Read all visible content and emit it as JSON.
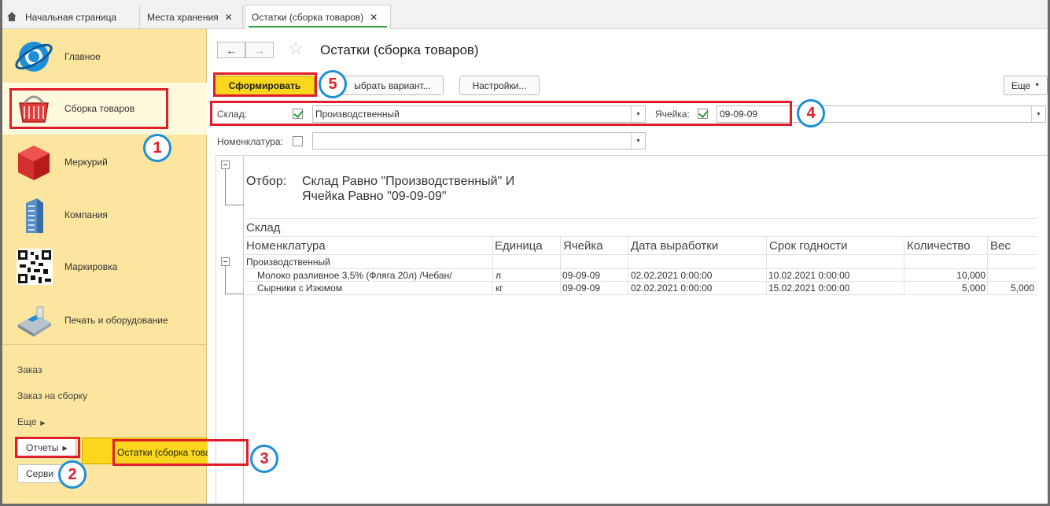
{
  "tabs": [
    {
      "label": "Начальная страница"
    },
    {
      "label": "Места хранения"
    },
    {
      "label": "Остатки (сборка товаров)"
    }
  ],
  "sidebar": {
    "sections": [
      {
        "label": "Главное",
        "icon": "globe-icon"
      },
      {
        "label": "Сборка товаров",
        "icon": "basket-icon"
      },
      {
        "label": "Меркурий",
        "icon": "cube-icon"
      },
      {
        "label": "Компания",
        "icon": "building-icon"
      },
      {
        "label": "Маркировка",
        "icon": "qr-code-icon"
      },
      {
        "label": "Печать и оборудование",
        "icon": "pos-terminal-icon"
      }
    ],
    "links": [
      {
        "label": "Заказ"
      },
      {
        "label": "Заказ на сборку"
      },
      {
        "label": "Еще"
      }
    ],
    "reports_button": "Отчеты",
    "service_button": "Серви"
  },
  "popup": {
    "item": "Остатки (сборка товаров)"
  },
  "page": {
    "title": "Остатки (сборка товаров)"
  },
  "toolbar": {
    "generate": "Сформировать",
    "choose_variant": "ыбрать вариант...",
    "settings": "Настройки...",
    "more": "Еще"
  },
  "filters": {
    "warehouse_label": "Склад:",
    "warehouse_value": "Производственный",
    "cell_label": "Ячейка:",
    "cell_value": "09-09-09",
    "nomenclature_label": "Номенклатура:",
    "nomenclature_value": ""
  },
  "report": {
    "filter_label": "Отбор:",
    "filter_line1": "Склад Равно \"Производственный\" И",
    "filter_line2": "Ячейка Равно \"09-09-09\"",
    "group_header": "Склад",
    "columns": [
      "Номенклатура",
      "Единица",
      "Ячейка",
      "Дата выработки",
      "Срок годности",
      "Количество",
      "Вес"
    ],
    "group_name": "Производственный",
    "rows": [
      [
        "Молоко разливное 3,5% (Фляга 20л) /Чебан/",
        "л",
        "09-09-09",
        "02.02.2021 0:00:00",
        "10.02.2021 0:00:00",
        "10,000",
        ""
      ],
      [
        "Сырники с Изюмом",
        "кг",
        "09-09-09",
        "02.02.2021 0:00:00",
        "15.02.2021 0:00:00",
        "5,000",
        "5,000"
      ]
    ]
  },
  "annotations": [
    "1",
    "2",
    "3",
    "4",
    "5"
  ],
  "colors": {
    "accent": "#fad71c",
    "sidebar": "#fce59e",
    "highlight": "#e11d2a",
    "badge_ring": "#1f8fd6"
  }
}
